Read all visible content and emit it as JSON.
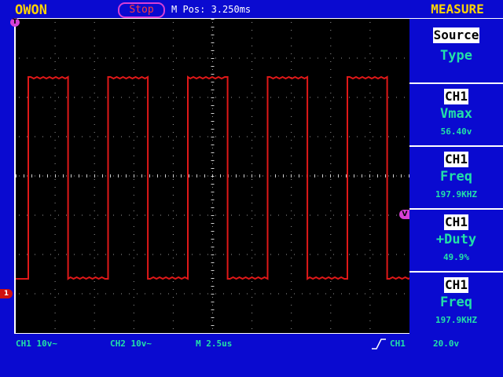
{
  "header": {
    "brand": "OWON",
    "run_state": "Stop",
    "m_pos": "M Pos: 3.250ms",
    "measure_title": "MEASURE"
  },
  "markers": {
    "trigger": "T",
    "ch1": "1",
    "level": "V"
  },
  "measure": {
    "source_label": "Source",
    "type_label": "Type",
    "items": [
      {
        "channel": "CH1",
        "name": "Vmax",
        "value": "56.40v"
      },
      {
        "channel": "CH1",
        "name": "Freq",
        "value": "197.9KHZ"
      },
      {
        "channel": "CH1",
        "name": "+Duty",
        "value": "49.9%"
      },
      {
        "channel": "CH1",
        "name": "Freq",
        "value": "197.9KHZ"
      }
    ]
  },
  "status": {
    "ch1": "CH1 10v~",
    "ch2": "CH2 10v~",
    "timebase": "M 2.5us",
    "trigger_source": "CH1",
    "trigger_level": "20.0v"
  },
  "waveform": {
    "color": "#e01818",
    "duty": 0.499,
    "cycles": 5
  }
}
